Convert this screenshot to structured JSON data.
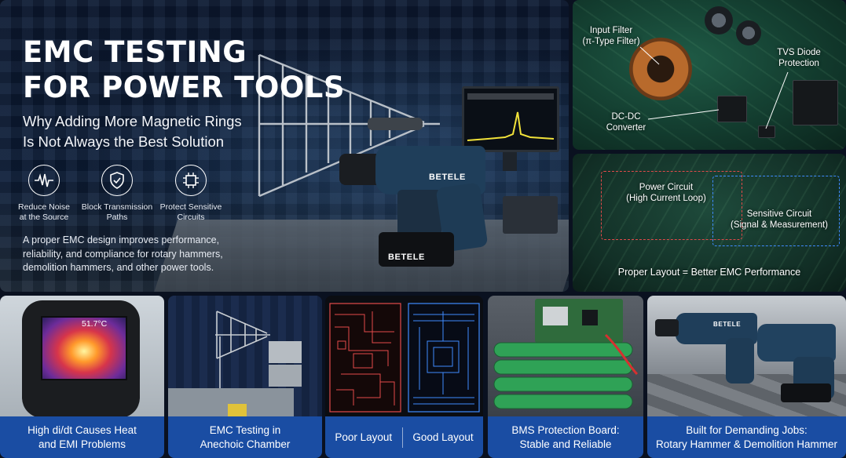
{
  "hero": {
    "title_line1": "EMC TESTING",
    "title_line2": "FOR POWER TOOLS",
    "subtitle_line1": "Why Adding More Magnetic Rings",
    "subtitle_line2": "Is Not Always the Best Solution",
    "features": [
      {
        "icon": "waveform-icon",
        "line1": "Reduce Noise",
        "line2": "at the Source"
      },
      {
        "icon": "shield-check-icon",
        "line1": "Block Transmission",
        "line2": "Paths"
      },
      {
        "icon": "chip-icon",
        "line1": "Protect Sensitive",
        "line2": "Circuits"
      }
    ],
    "body_line1": "A proper EMC design improves performance,",
    "body_line2": "reliability, and compliance for rotary hammers,",
    "body_line3": "demolition hammers, and other power tools.",
    "drill_brand": "BETELE",
    "battery_brand": "BETELE"
  },
  "pcb_top": {
    "input_filter_line1": "Input Filter",
    "input_filter_line2": "(π-Type Filter)",
    "tvs_line1": "TVS Diode",
    "tvs_line2": "Protection",
    "dcdc_line1": "DC-DC",
    "dcdc_line2": "Converter"
  },
  "pcb_mid": {
    "power_line1": "Power Circuit",
    "power_line2": "(High Current Loop)",
    "sensitive_line1": "Sensitive Circuit",
    "sensitive_line2": "(Signal & Measurement)",
    "footer": "Proper Layout = Better EMC Performance"
  },
  "cards": {
    "thermal": {
      "reading": "51.7°C",
      "caption_line1": "High di/dt Causes Heat",
      "caption_line2": "and EMI Problems"
    },
    "chamber": {
      "caption_line1": "EMC Testing in",
      "caption_line2": "Anechoic Chamber"
    },
    "layout": {
      "poor": "Poor Layout",
      "good": "Good Layout"
    },
    "bms": {
      "caption_line1": "BMS Protection Board:",
      "caption_line2": "Stable and Reliable"
    },
    "hammers": {
      "brand": "BETELE",
      "caption_line1": "Built for Demanding Jobs:",
      "caption_line2": "Rotary Hammer & Demolition Hammer"
    }
  },
  "colors": {
    "caption_blue": "#1a4da3",
    "poor_layout_red": "#e34a4a",
    "good_layout_blue": "#3f8bff",
    "pcb_green": "#1f5b46"
  }
}
